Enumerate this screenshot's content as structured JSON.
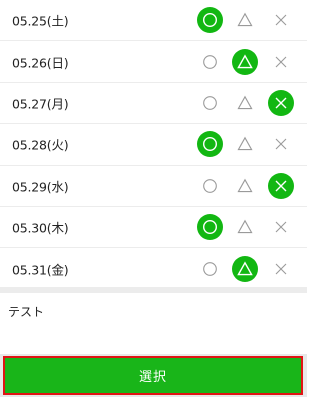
{
  "rows": [
    {
      "date": "05.25(土)",
      "selected": "circle"
    },
    {
      "date": "05.26(日)",
      "selected": "triangle"
    },
    {
      "date": "05.27(月)",
      "selected": "cross"
    },
    {
      "date": "05.28(火)",
      "selected": "circle"
    },
    {
      "date": "05.29(水)",
      "selected": "cross"
    },
    {
      "date": "05.30(木)",
      "selected": "circle"
    },
    {
      "date": "05.31(金)",
      "selected": "triangle"
    }
  ],
  "comment": {
    "text": "テスト"
  },
  "submit": {
    "label": "選択"
  },
  "colors": {
    "selected_bg": "#12b712",
    "submit_bg": "#19b519",
    "submit_border": "#e01414",
    "icon_gray": "#9a9a9a"
  }
}
